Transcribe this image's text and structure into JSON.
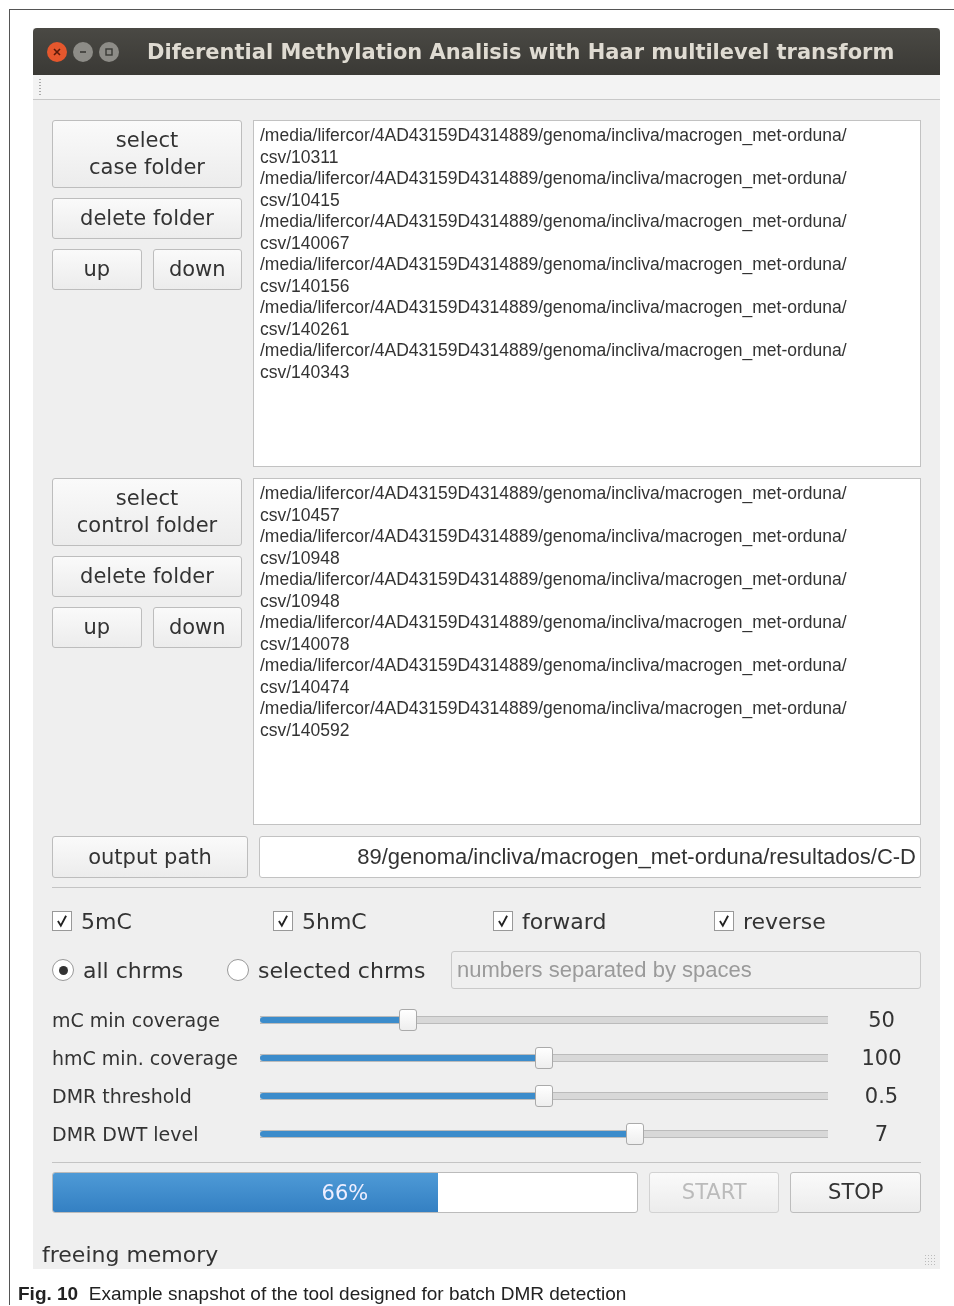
{
  "window": {
    "title": "Diferential Methylation Analisis with Haar multilevel transform"
  },
  "groups": [
    {
      "select_button": "select\ncase folder",
      "delete_button": "delete folder",
      "up_button": "up",
      "down_button": "down",
      "folders": [
        {
          "line_1": "/media/lifercor/4AD43159D4314889/genoma/incliva/macrogen_met-orduna/",
          "line_2": "csv/10311"
        },
        {
          "line_1": "/media/lifercor/4AD43159D4314889/genoma/incliva/macrogen_met-orduna/",
          "line_2": "csv/10415"
        },
        {
          "line_1": "/media/lifercor/4AD43159D4314889/genoma/incliva/macrogen_met-orduna/",
          "line_2": "csv/140067"
        },
        {
          "line_1": "/media/lifercor/4AD43159D4314889/genoma/incliva/macrogen_met-orduna/",
          "line_2": "csv/140156"
        },
        {
          "line_1": "/media/lifercor/4AD43159D4314889/genoma/incliva/macrogen_met-orduna/",
          "line_2": "csv/140261"
        },
        {
          "line_1": "/media/lifercor/4AD43159D4314889/genoma/incliva/macrogen_met-orduna/",
          "line_2": "csv/140343"
        }
      ]
    },
    {
      "select_button": "select\ncontrol folder",
      "delete_button": "delete folder",
      "up_button": "up",
      "down_button": "down",
      "folders": [
        {
          "line_1": "/media/lifercor/4AD43159D4314889/genoma/incliva/macrogen_met-orduna/",
          "line_2": "csv/10457"
        },
        {
          "line_1": "/media/lifercor/4AD43159D4314889/genoma/incliva/macrogen_met-orduna/",
          "line_2": "csv/10948"
        },
        {
          "line_1": "/media/lifercor/4AD43159D4314889/genoma/incliva/macrogen_met-orduna/",
          "line_2": "csv/10948"
        },
        {
          "line_1": "/media/lifercor/4AD43159D4314889/genoma/incliva/macrogen_met-orduna/",
          "line_2": "csv/140078"
        },
        {
          "line_1": "/media/lifercor/4AD43159D4314889/genoma/incliva/macrogen_met-orduna/",
          "line_2": "csv/140474"
        },
        {
          "line_1": "/media/lifercor/4AD43159D4314889/genoma/incliva/macrogen_met-orduna/",
          "line_2": "csv/140592"
        }
      ]
    }
  ],
  "output": {
    "button": "output path",
    "value": "89/genoma/incliva/macrogen_met-orduna/resultados/C-D"
  },
  "checkboxes": [
    {
      "label": "5mC",
      "checked": true
    },
    {
      "label": "5hmC",
      "checked": true
    },
    {
      "label": "forward",
      "checked": true
    },
    {
      "label": "reverse",
      "checked": true
    }
  ],
  "radios": [
    {
      "label": "all chrms",
      "selected": true
    },
    {
      "label": "selected chrms",
      "selected": false
    }
  ],
  "chromosomes_field": {
    "placeholder": "numbers separated by spaces"
  },
  "sliders": [
    {
      "label": "mC min coverage",
      "level": 0.26,
      "reading": "50"
    },
    {
      "label": "hmC min. coverage",
      "level": 0.5,
      "reading": "100"
    },
    {
      "label": "DMR threshold",
      "level": 0.5,
      "reading": "0.5"
    },
    {
      "label": "DMR DWT level",
      "level": 0.66,
      "reading": "7"
    }
  ],
  "progress": {
    "level": 0.66,
    "text": "66%"
  },
  "buttons": [
    {
      "label": "START",
      "disabled": true
    },
    {
      "label": "STOP",
      "disabled": false
    }
  ],
  "status_bar": "freeing memory",
  "caption": {
    "label": "Fig. 10",
    "text": "Example snapshot of the tool designed for batch DMR detection"
  }
}
